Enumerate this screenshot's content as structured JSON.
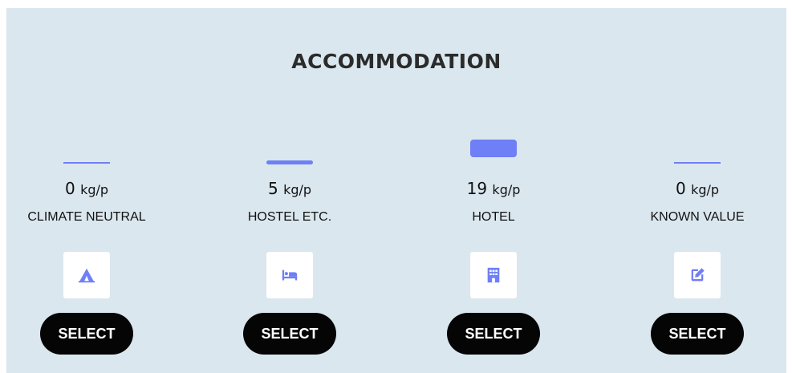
{
  "title": "ACCOMMODATION",
  "accent_color": "#6f7ff5",
  "options": [
    {
      "value": "0",
      "unit": "kg/p",
      "label": "CLIMATE NEUTRAL",
      "icon": "campground-icon",
      "button": "SELECT",
      "level": 0
    },
    {
      "value": "5",
      "unit": "kg/p",
      "label": "HOSTEL ETC.",
      "icon": "bed-icon",
      "button": "SELECT",
      "level": 5
    },
    {
      "value": "19",
      "unit": "kg/p",
      "label": "HOTEL",
      "icon": "hotel-building-icon",
      "button": "SELECT",
      "level": 19
    },
    {
      "value": "0",
      "unit": "kg/p",
      "label": "KNOWN VALUE",
      "icon": "edit-icon",
      "button": "SELECT",
      "level": 0
    }
  ]
}
